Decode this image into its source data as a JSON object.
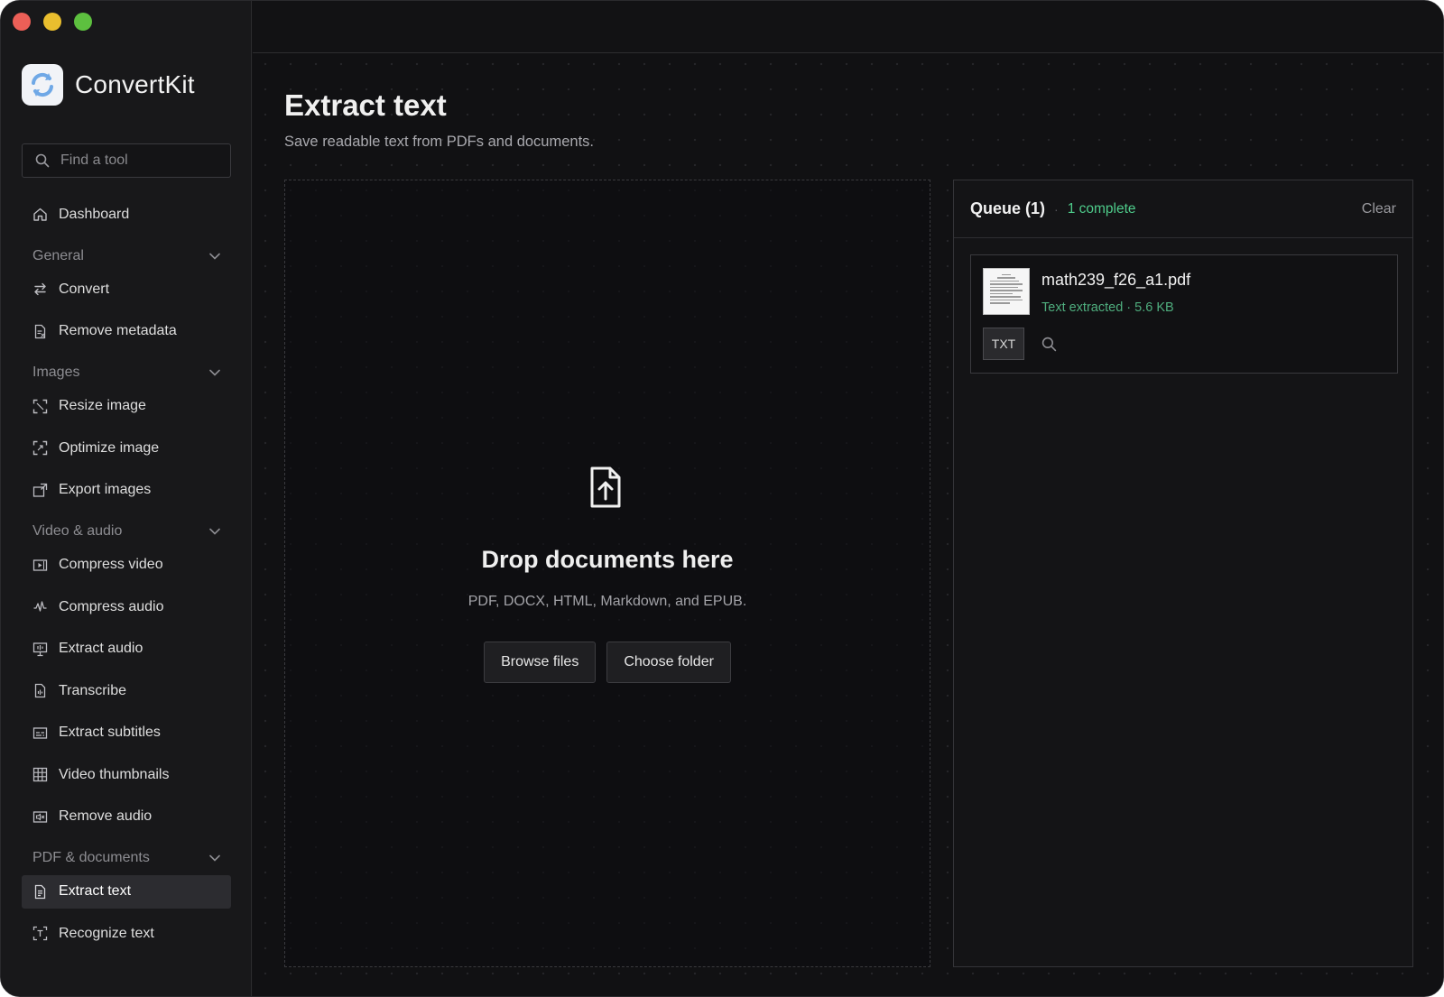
{
  "app": {
    "name": "ConvertKit"
  },
  "search": {
    "placeholder": "Find a tool"
  },
  "nav": {
    "dashboard": "Dashboard",
    "sections": {
      "general": "General",
      "images": "Images",
      "video_audio": "Video & audio",
      "pdf_documents": "PDF & documents"
    },
    "items": {
      "convert": "Convert",
      "remove_metadata": "Remove metadata",
      "resize_image": "Resize image",
      "optimize_image": "Optimize image",
      "export_images": "Export images",
      "compress_video": "Compress video",
      "compress_audio": "Compress audio",
      "extract_audio": "Extract audio",
      "transcribe": "Transcribe",
      "extract_subtitles": "Extract subtitles",
      "video_thumbnails": "Video thumbnails",
      "remove_audio": "Remove audio",
      "extract_text": "Extract text",
      "recognize_text": "Recognize text"
    },
    "active": "extract_text"
  },
  "page": {
    "title": "Extract text",
    "subtitle": "Save readable text from PDFs and documents."
  },
  "dropzone": {
    "title": "Drop documents here",
    "formats": "PDF, DOCX, HTML, Markdown, and EPUB.",
    "browse_label": "Browse files",
    "folder_label": "Choose folder"
  },
  "queue": {
    "title": "Queue (1)",
    "complete": "1 complete",
    "clear_label": "Clear",
    "files": [
      {
        "name": "math239_f26_a1.pdf",
        "status": "Text extracted",
        "size": "5.6 KB",
        "format": "TXT"
      }
    ]
  },
  "colors": {
    "accent_green": "#4ecb8a",
    "background": "#121214",
    "sidebar": "#18181a",
    "active_item": "#2c2c30"
  }
}
